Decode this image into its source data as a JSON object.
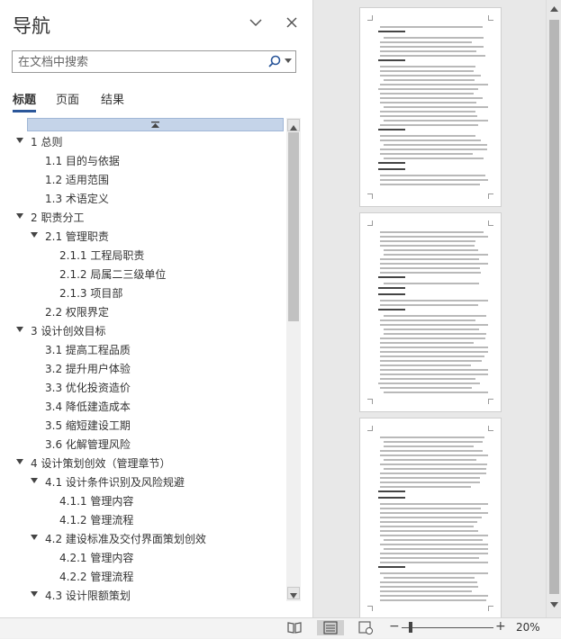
{
  "nav": {
    "title": "导航",
    "search_placeholder": "在文档中搜索",
    "tabs": [
      "标题",
      "页面",
      "结果"
    ],
    "tree": [
      {
        "label": "1 总则",
        "level": 1,
        "expanded": true
      },
      {
        "label": "1.1 目的与依据",
        "level": 2,
        "expanded": null
      },
      {
        "label": "1.2 适用范围",
        "level": 2,
        "expanded": null
      },
      {
        "label": "1.3 术语定义",
        "level": 2,
        "expanded": null
      },
      {
        "label": "2 职责分工",
        "level": 1,
        "expanded": true
      },
      {
        "label": "2.1 管理职责",
        "level": 2,
        "expanded": true
      },
      {
        "label": "2.1.1 工程局职责",
        "level": 3,
        "expanded": null
      },
      {
        "label": "2.1.2 局属二三级单位",
        "level": 3,
        "expanded": null
      },
      {
        "label": "2.1.3 项目部",
        "level": 3,
        "expanded": null
      },
      {
        "label": "2.2 权限界定",
        "level": 2,
        "expanded": null
      },
      {
        "label": "3 设计创效目标",
        "level": 1,
        "expanded": true
      },
      {
        "label": "3.1 提高工程品质",
        "level": 2,
        "expanded": null
      },
      {
        "label": "3.2 提升用户体验",
        "level": 2,
        "expanded": null
      },
      {
        "label": "3.3 优化投资造价",
        "level": 2,
        "expanded": null
      },
      {
        "label": "3.4 降低建造成本",
        "level": 2,
        "expanded": null
      },
      {
        "label": "3.5 缩短建设工期",
        "level": 2,
        "expanded": null
      },
      {
        "label": "3.6 化解管理风险",
        "level": 2,
        "expanded": null
      },
      {
        "label": "4 设计策划创效（管理章节）",
        "level": 1,
        "expanded": true
      },
      {
        "label": "4.1 设计条件识别及风险规避",
        "level": 2,
        "expanded": true
      },
      {
        "label": "4.1.1 管理内容",
        "level": 3,
        "expanded": null
      },
      {
        "label": "4.1.2 管理流程",
        "level": 3,
        "expanded": null
      },
      {
        "label": "4.2 建设标准及交付界面策划创效",
        "level": 2,
        "expanded": true
      },
      {
        "label": "4.2.1 管理内容",
        "level": 3,
        "expanded": null
      },
      {
        "label": "4.2.2 管理流程",
        "level": 3,
        "expanded": null
      },
      {
        "label": "4.3 设计限额策划",
        "level": 2,
        "expanded": true
      }
    ]
  },
  "status": {
    "zoom_label": "20%",
    "zoom_fraction": 0.1,
    "minus": "−",
    "plus": "+"
  },
  "icons": {
    "collapse": "chevron-down-icon",
    "close": "close-icon",
    "search": "search-icon",
    "read_mode": "book-icon",
    "print_layout": "page-layout-icon",
    "web_layout": "web-layout-icon"
  },
  "colors": {
    "accent": "#2b579a",
    "selection_band": "#c5d4e9"
  }
}
